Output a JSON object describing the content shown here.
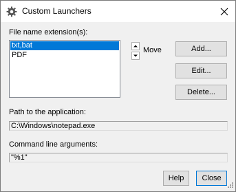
{
  "window": {
    "title": "Custom Launchers",
    "close_glyph": "✕",
    "icon": "gear-icon"
  },
  "extensions": {
    "label": "File name extension(s):",
    "items": [
      {
        "text": "txt,bat",
        "selected": true
      },
      {
        "text": "PDF",
        "selected": false
      }
    ],
    "move_label": "Move"
  },
  "buttons": {
    "add": "Add...",
    "edit": "Edit...",
    "delete": "Delete...",
    "help": "Help",
    "close": "Close"
  },
  "path": {
    "label": "Path to the application:",
    "value": "C:\\Windows\\notepad.exe"
  },
  "args": {
    "label": "Command line arguments:",
    "value": "\"%1\""
  },
  "colors": {
    "selection": "#0078d7",
    "dialog_bg": "#f0f0f0",
    "button_bg": "#e1e1e1"
  }
}
